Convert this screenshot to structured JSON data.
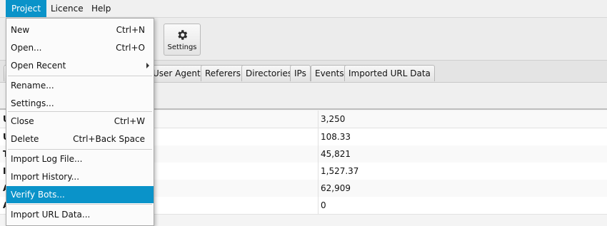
{
  "menubar": {
    "items": [
      "Project",
      "Licence",
      "Help"
    ]
  },
  "toolbar": {
    "settings_label": "Settings"
  },
  "tabs": [
    "User Agents",
    "Referers",
    "Directories",
    "IPs",
    "Events",
    "Imported URL Data"
  ],
  "table": {
    "rows": [
      {
        "key": "U",
        "value": "3,250"
      },
      {
        "key": "U",
        "value": "108.33"
      },
      {
        "key": "T",
        "value": "45,821"
      },
      {
        "key": "I",
        "value": "1,527.37"
      },
      {
        "key": "A",
        "value": "62,909"
      },
      {
        "key": "A",
        "value": "0"
      }
    ]
  },
  "project_menu": {
    "items": [
      {
        "label": "New",
        "accel": "Ctrl+N"
      },
      {
        "label": "Open...",
        "accel": "Ctrl+O"
      },
      {
        "label": "Open Recent",
        "accel": ""
      },
      {
        "label": "Rename...",
        "accel": ""
      },
      {
        "label": "Settings...",
        "accel": ""
      },
      {
        "label": "Close",
        "accel": "Ctrl+W"
      },
      {
        "label": "Delete",
        "accel": "Ctrl+Back Space"
      },
      {
        "label": "Import Log File...",
        "accel": ""
      },
      {
        "label": "Import History...",
        "accel": ""
      },
      {
        "label": "Verify Bots...",
        "accel": ""
      },
      {
        "label": "Import URL Data...",
        "accel": ""
      }
    ]
  },
  "colors": {
    "accent": "#0a93c9"
  }
}
